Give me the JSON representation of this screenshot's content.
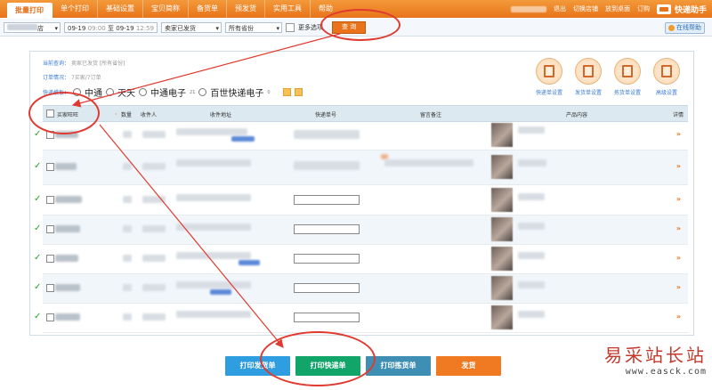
{
  "topbar": {
    "tabs": [
      {
        "label": "批量打印",
        "active": true
      },
      {
        "label": "单个打印"
      },
      {
        "label": "基础设置"
      },
      {
        "label": "宝贝简称"
      },
      {
        "label": "备货单"
      },
      {
        "label": "预发货"
      },
      {
        "label": "实用工具"
      },
      {
        "label": "帮助"
      }
    ],
    "links": [
      "退出",
      "切换店铺",
      "放到桌面",
      "订购"
    ],
    "brand": "快递助手"
  },
  "filter": {
    "store_suffix": "店",
    "date_from": "09-19",
    "time_from": "09:00",
    "to_word": "至",
    "date_to": "09-19",
    "time_to": "12:59",
    "status": "卖家已发货",
    "province": "所有省份",
    "more_options": "更多选项",
    "query_button": "查 询",
    "help": "在线帮助"
  },
  "info": {
    "query_label": "当前查询：",
    "query_value": "卖家已发货 [所有省份]",
    "order_label": "订单情况：",
    "order_value": "7买家/7订单",
    "carrier_label": "快递模板："
  },
  "carriers": [
    {
      "name": "中通",
      "count": ""
    },
    {
      "name": "天天",
      "count": ""
    },
    {
      "name": "中通电子",
      "count": "21"
    },
    {
      "name": "百世快递电子",
      "count": "0"
    }
  ],
  "tools": [
    {
      "label": "快递单设置",
      "icon": "waybill-settings-icon"
    },
    {
      "label": "发货单设置",
      "icon": "invoice-settings-icon"
    },
    {
      "label": "拣货单设置",
      "icon": "picklist-settings-icon"
    },
    {
      "label": "高级设置",
      "icon": "advanced-settings-icon"
    }
  ],
  "table": {
    "headers": {
      "buyer": "买家旺旺",
      "qty": "数量",
      "recipient": "收件人",
      "address": "收件地址",
      "tracking": "快递单号",
      "remark": "留言备注",
      "product": "产品内容",
      "detail": "详情"
    },
    "row_count": 7
  },
  "buttons": {
    "print_invoice": "打印发货单",
    "print_waybill": "打印快递单",
    "print_picklist": "打印拣货单",
    "ship": "发货"
  },
  "colors": {
    "accent": "#e8731a",
    "blue_button": "#2f9ee0",
    "green_button": "#12a56a",
    "gray_blue_button": "#3f8fb4",
    "annotation": "#e03a30"
  },
  "watermark": {
    "cn": "易采站长站",
    "url": "www.easck.com"
  }
}
